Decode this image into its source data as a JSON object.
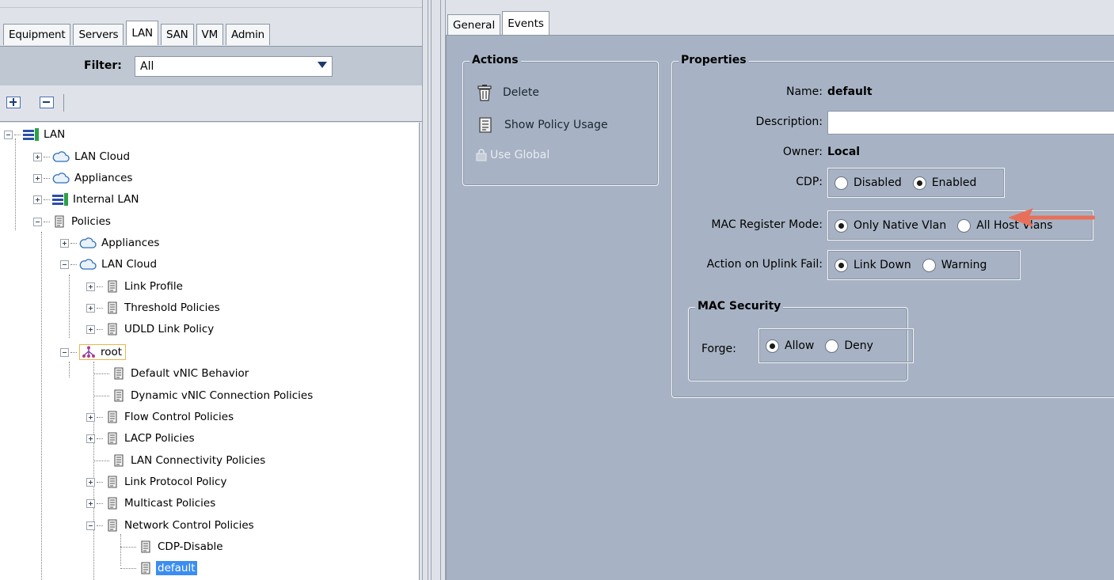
{
  "left": {
    "tabs": [
      {
        "label": "Equipment"
      },
      {
        "label": "Servers"
      },
      {
        "label": "LAN"
      },
      {
        "label": "SAN"
      },
      {
        "label": "VM"
      },
      {
        "label": "Admin"
      }
    ],
    "active_tab": "LAN",
    "filter": {
      "label": "Filter:",
      "value": "All"
    },
    "tree": [
      {
        "label": "LAN"
      },
      {
        "label": "LAN Cloud"
      },
      {
        "label": "Appliances"
      },
      {
        "label": "Internal LAN"
      },
      {
        "label": "Policies"
      },
      {
        "label": "Appliances"
      },
      {
        "label": "LAN Cloud"
      },
      {
        "label": "Link Profile"
      },
      {
        "label": "Threshold Policies"
      },
      {
        "label": "UDLD Link Policy"
      },
      {
        "label": "root"
      },
      {
        "label": "Default vNIC Behavior"
      },
      {
        "label": "Dynamic vNIC Connection Policies"
      },
      {
        "label": "Flow Control Policies"
      },
      {
        "label": "LACP Policies"
      },
      {
        "label": "LAN Connectivity Policies"
      },
      {
        "label": "Link Protocol Policy"
      },
      {
        "label": "Multicast Policies"
      },
      {
        "label": "Network Control Policies"
      },
      {
        "label": "CDP-Disable"
      },
      {
        "label": "default"
      }
    ]
  },
  "right": {
    "tabs": [
      {
        "label": "General"
      },
      {
        "label": "Events"
      }
    ],
    "active_tab": "General",
    "actions": {
      "title": "Actions",
      "delete": "Delete",
      "show_usage": "Show Policy Usage",
      "use_global": "Use Global"
    },
    "properties": {
      "title": "Properties",
      "name_label": "Name:",
      "name_value": "default",
      "description_label": "Description:",
      "description_value": "",
      "owner_label": "Owner:",
      "owner_value": "Local",
      "cdp_label": "CDP:",
      "cdp_options": [
        "Disabled",
        "Enabled"
      ],
      "cdp_selected": "Enabled",
      "mac_register_label": "MAC Register Mode:",
      "mac_register_options": [
        "Only Native Vlan",
        "All Host Vlans"
      ],
      "mac_register_selected": "Only Native Vlan",
      "uplink_fail_label": "Action on Uplink Fail:",
      "uplink_fail_options": [
        "Link Down",
        "Warning"
      ],
      "uplink_fail_selected": "Link Down",
      "mac_security": {
        "title": "MAC Security",
        "forge_label": "Forge:",
        "forge_options": [
          "Allow",
          "Deny"
        ],
        "forge_selected": "Allow"
      }
    }
  },
  "colors": {
    "panel_bg": "#a7b3c4",
    "selection": "#3b8df0",
    "arrow": "#e8705a"
  }
}
